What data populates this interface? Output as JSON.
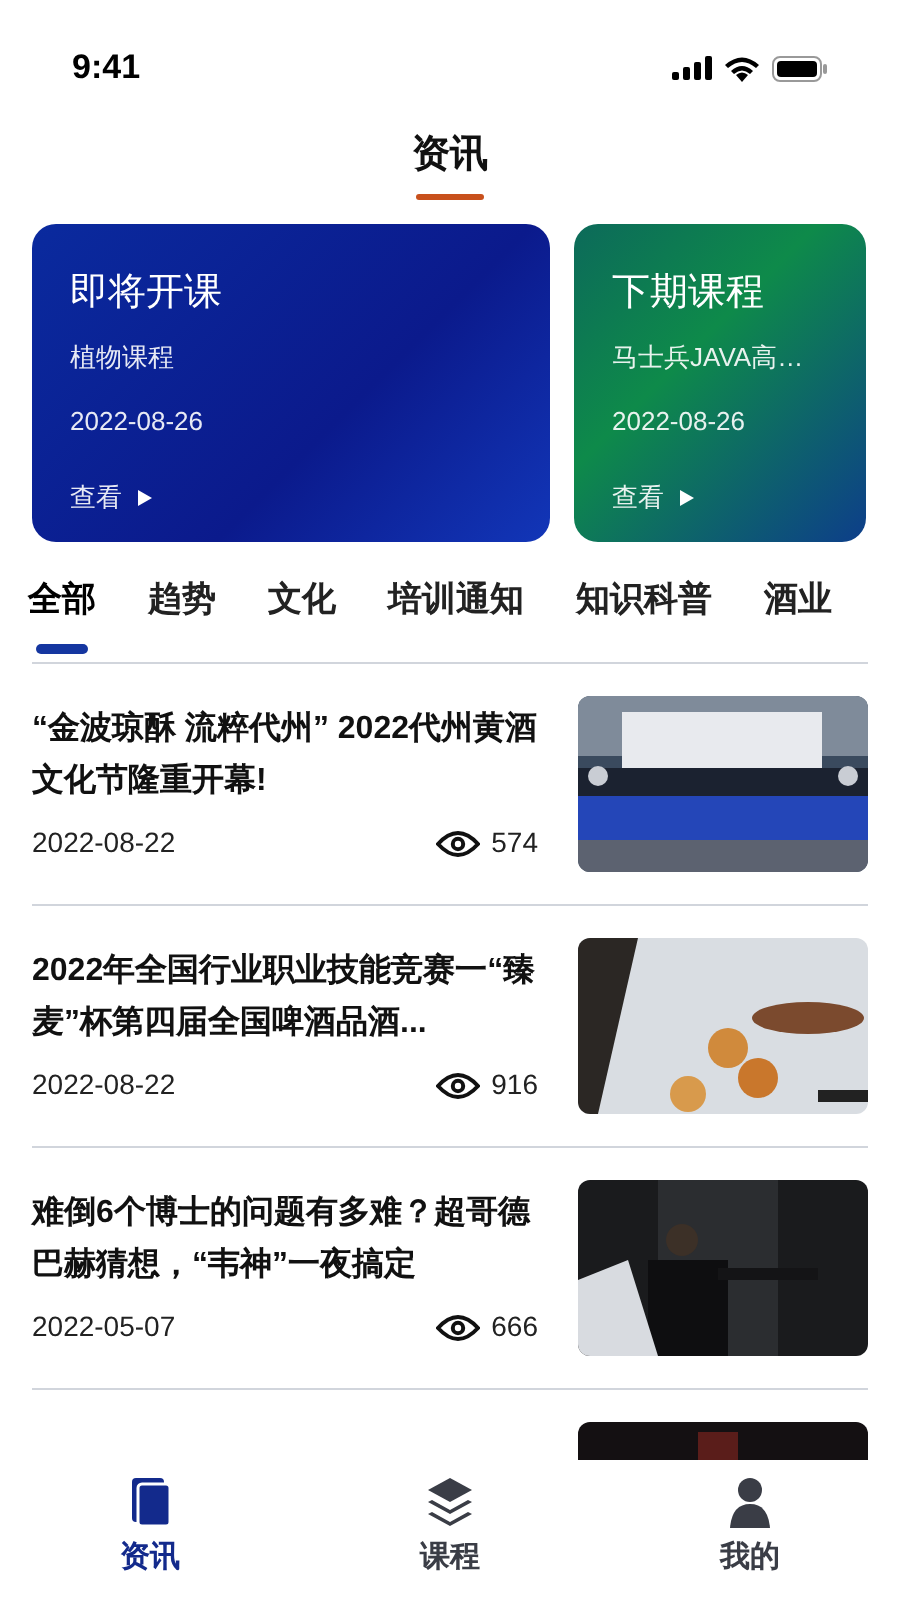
{
  "status_bar": {
    "time": "9:41"
  },
  "header": {
    "title": "资讯"
  },
  "course_cards": [
    {
      "kind": "blue",
      "title": "即将开课",
      "subtitle": "植物课程",
      "date": "2022-08-26",
      "link": "查看"
    },
    {
      "kind": "green",
      "title": "下期课程",
      "subtitle": "马士兵JAVA高…",
      "date": "2022-08-26",
      "link": "查看"
    }
  ],
  "category_tabs": [
    {
      "label": "全部",
      "selected": true
    },
    {
      "label": "趋势",
      "selected": false
    },
    {
      "label": "文化",
      "selected": false
    },
    {
      "label": "培训通知",
      "selected": false
    },
    {
      "label": "知识科普",
      "selected": false
    },
    {
      "label": "酒业",
      "selected": false
    }
  ],
  "articles": [
    {
      "title": "“金波琼酥 流粹代州” 2022代州黄酒文化节隆重开幕!",
      "date": "2022-08-22",
      "views": "574",
      "kind": "stage"
    },
    {
      "title": "2022年全国行业职业技能竞赛一“臻麦”杯第四届全国啤酒品酒...",
      "date": "2022-08-22",
      "views": "916",
      "kind": "glasses"
    },
    {
      "title": "难倒6个博士的问题有多难？超哥德巴赫猜想，“韦神”一夜搞定",
      "date": "2022-05-07",
      "views": "666",
      "kind": "dark"
    }
  ],
  "bottom_nav": [
    {
      "label": "资讯",
      "selected": true,
      "kind": "news"
    },
    {
      "label": "课程",
      "selected": false,
      "kind": "layers"
    },
    {
      "label": "我的",
      "selected": false,
      "kind": "user"
    }
  ]
}
